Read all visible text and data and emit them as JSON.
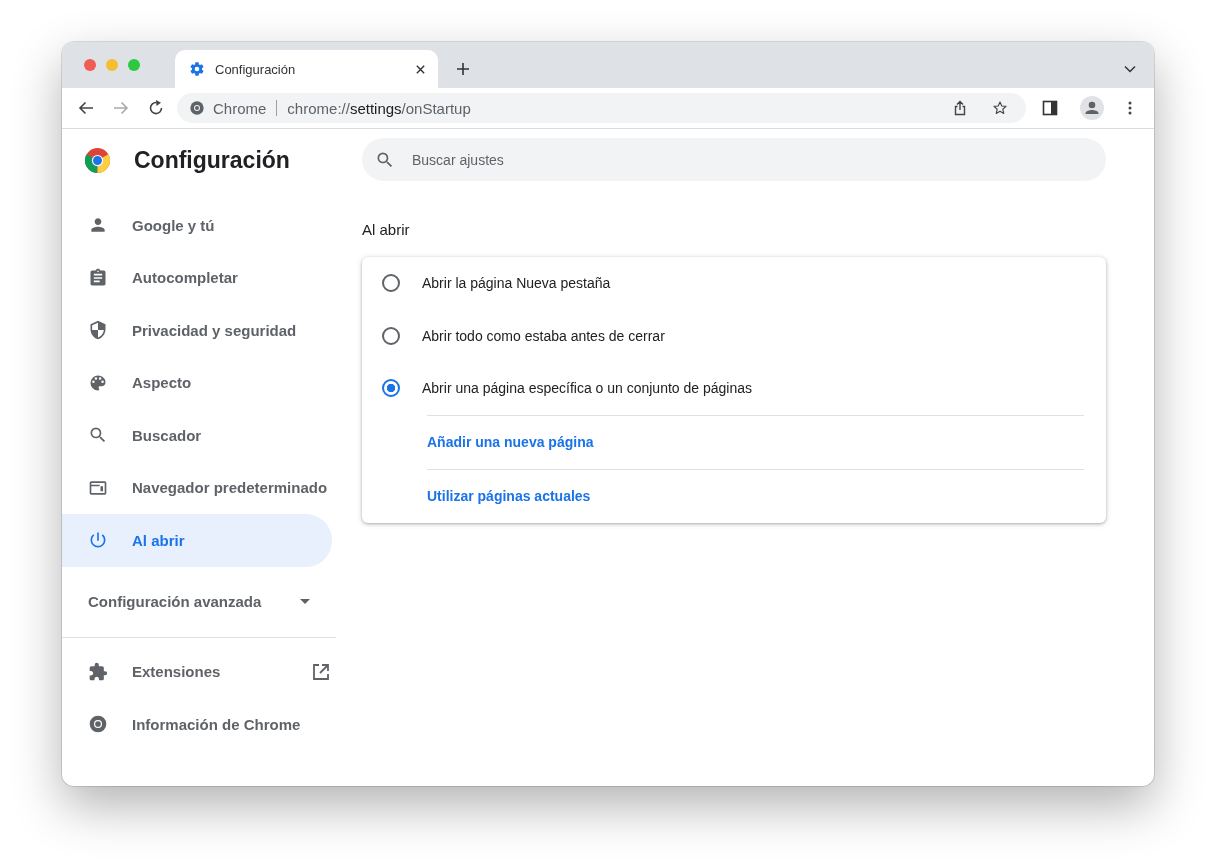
{
  "browser": {
    "tab": {
      "title": "Configuración"
    },
    "address_bar": {
      "site_label": "Chrome",
      "url": "chrome://**settings**/onStartup"
    }
  },
  "sidebar": {
    "title": "Configuración",
    "items": [
      {
        "label": "Google y tú",
        "selected": false
      },
      {
        "label": "Autocompletar",
        "selected": false
      },
      {
        "label": "Privacidad y seguridad",
        "selected": false
      },
      {
        "label": "Aspecto",
        "selected": false
      },
      {
        "label": "Buscador",
        "selected": false
      },
      {
        "label": "Navegador predeterminado",
        "selected": false
      },
      {
        "label": "Al abrir",
        "selected": true
      }
    ],
    "advanced": {
      "label": "Configuración avanzada",
      "expanded": false
    },
    "footer_items": [
      {
        "label": "Extensiones"
      },
      {
        "label": "Información de Chrome"
      }
    ]
  },
  "search": {
    "placeholder": "Buscar ajustes"
  },
  "section": {
    "title": "Al abrir",
    "options": [
      {
        "label": "Abrir la página Nueva pestaña",
        "selected": false
      },
      {
        "label": "Abrir todo como estaba antes de cerrar",
        "selected": false
      },
      {
        "label": "Abrir una página específica o un conjunto de páginas",
        "selected": true
      }
    ],
    "links": [
      "Añadir una nueva página",
      "Utilizar páginas actuales"
    ]
  }
}
